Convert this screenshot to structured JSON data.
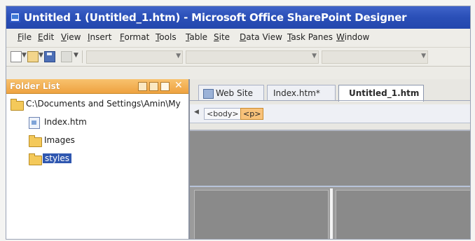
{
  "window": {
    "title": "Untitled 1 (Untitled_1.htm) - Microsoft Office SharePoint Designer"
  },
  "menu": [
    "File",
    "Edit",
    "View",
    "Insert",
    "Format",
    "Tools",
    "Table",
    "Site",
    "Data View",
    "Task Panes",
    "Window"
  ],
  "folder_list": {
    "title": "Folder List",
    "root": "C:\\Documents and Settings\\Amin\\My",
    "items": [
      {
        "label": "Index.htm",
        "icon": "html-file-icon"
      },
      {
        "label": "Images",
        "icon": "folder-icon"
      },
      {
        "label": "styles",
        "icon": "folder-icon",
        "selected": true
      }
    ]
  },
  "tabs": [
    {
      "label": "Web Site",
      "icon": "web-site-icon"
    },
    {
      "label": "Index.htm*",
      "icon": "html-file-icon"
    },
    {
      "label": "Untitled_1.htm",
      "active": true
    }
  ],
  "tag_selector": [
    "<body>",
    "<p>"
  ],
  "colors": {
    "title_bar": "#2a4fb7",
    "panel_header": "#eea240",
    "selection": "#2f57b0",
    "active_tag": "#f8c27a"
  }
}
